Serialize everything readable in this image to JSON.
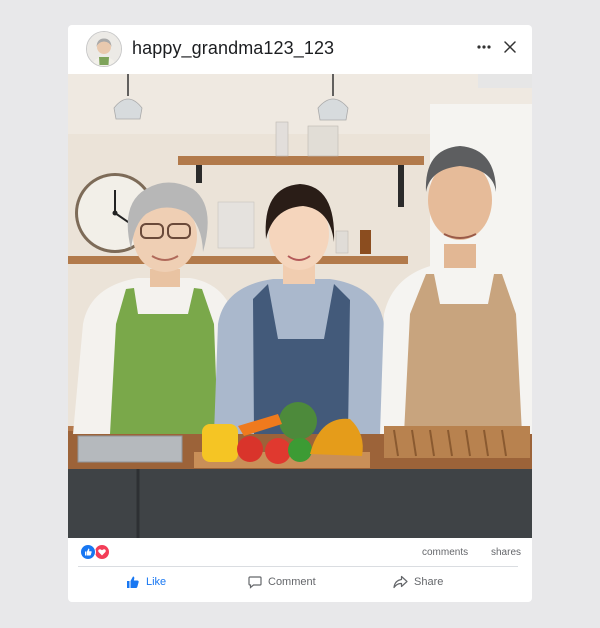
{
  "post": {
    "username": "happy_grandma123_123",
    "avatar_icon": "grandma-avatar",
    "menu_icon": "more-icon",
    "close_icon": "close-icon"
  },
  "stats": {
    "reactions": [
      "like-reaction",
      "love-reaction"
    ],
    "comments_label": "comments",
    "shares_label": "shares"
  },
  "actions": {
    "like_label": "Like",
    "comment_label": "Comment",
    "share_label": "Share"
  },
  "colors": {
    "like_blue": "#1877f2",
    "love_red": "#f33e58",
    "secondary_text": "#65676b"
  }
}
